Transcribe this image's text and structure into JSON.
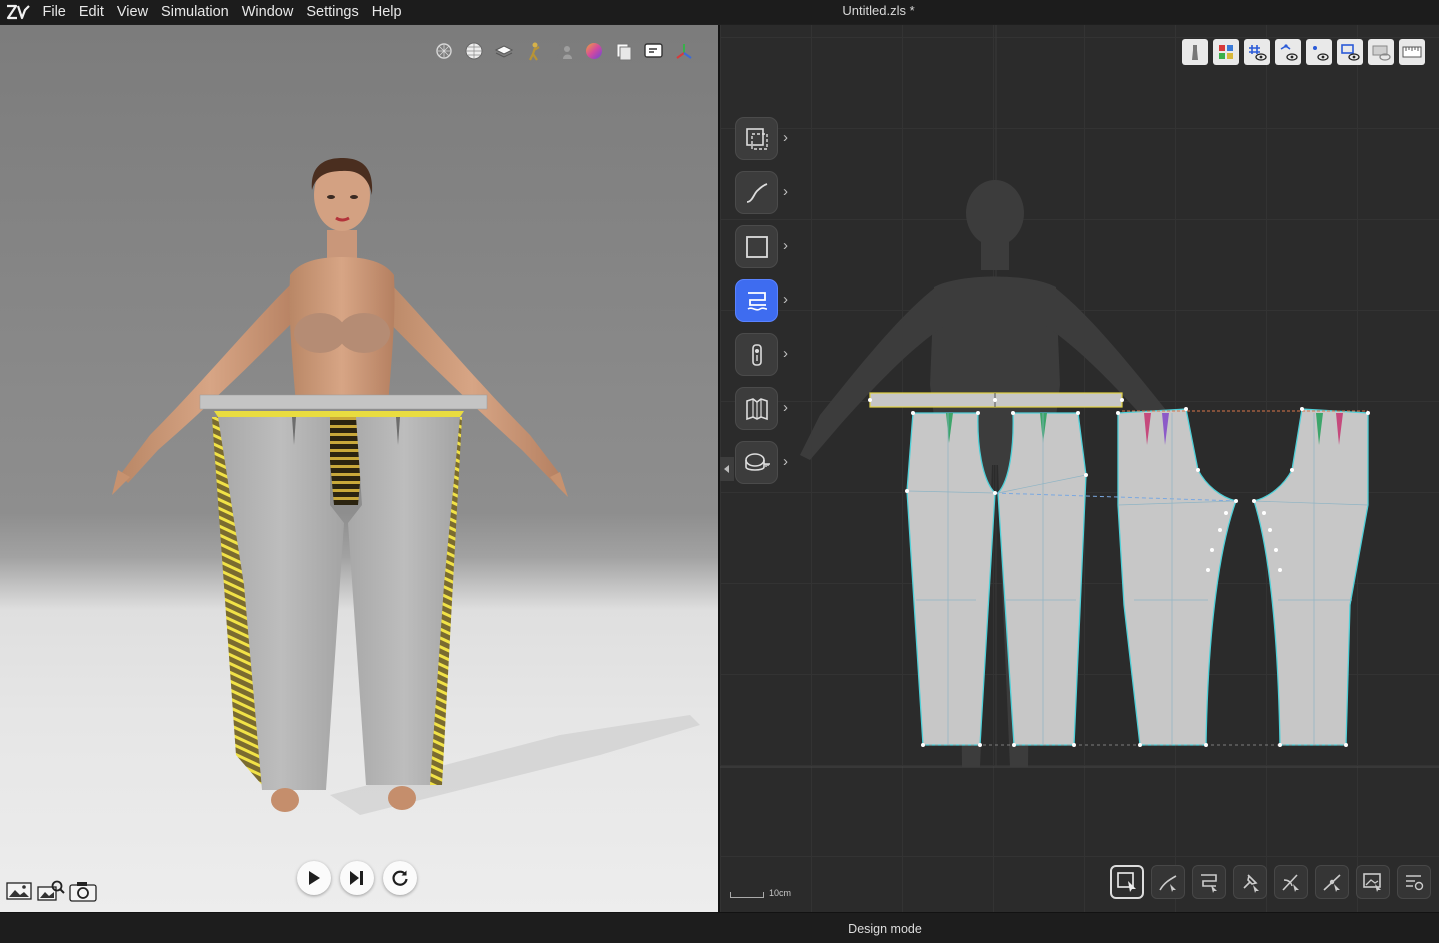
{
  "app": {
    "logo_text": "ZW",
    "menu": [
      "File",
      "Edit",
      "View",
      "Simulation",
      "Window",
      "Settings",
      "Help"
    ],
    "document_title": "Untitled.zls *"
  },
  "viewport3d": {
    "toolbar_icons": [
      "particle-icon",
      "sphere-shading-icon",
      "fabric-layer-icon",
      "avatar-pose-icon",
      "avatar-group-icon",
      "color-sphere-icon",
      "garment-copy-icon",
      "sewing-icon",
      "gizmo-icon"
    ],
    "simulation_controls": [
      "play-icon",
      "step-forward-icon",
      "reset-icon"
    ],
    "capture_tools": [
      "snapshot-gallery-icon",
      "render-search-icon",
      "camera-icon"
    ]
  },
  "viewport2d": {
    "top_toolbar_icons": [
      "avatar-silhouette-icon",
      "color-grid-icon",
      "grid-hash-eye-icon",
      "point-eye-icon",
      "baseline-eye-icon",
      "seam-eye-icon",
      "sheet-eye-icon",
      "ruler-icon"
    ],
    "tool_palette": [
      {
        "name": "transform-tool",
        "icon": "transform-icon",
        "active": false
      },
      {
        "name": "curve-tool",
        "icon": "curve-icon",
        "active": false
      },
      {
        "name": "rectangle-tool",
        "icon": "rectangle-icon",
        "active": false
      },
      {
        "name": "sewing-tool",
        "icon": "sewing-icon",
        "active": true
      },
      {
        "name": "zipper-tool",
        "icon": "zipper-icon",
        "active": false
      },
      {
        "name": "fold-tool",
        "icon": "fold-icon",
        "active": false
      },
      {
        "name": "measure-tool",
        "icon": "tape-measure-icon",
        "active": false
      }
    ],
    "scale_label": "10cm",
    "bottom_toolbar_icons": [
      "select-box-icon",
      "edit-curve-icon",
      "seam-edit-icon",
      "pin-edit-icon",
      "cut-line-icon",
      "point-add-icon",
      "image-edit-icon",
      "settings-list-icon"
    ]
  },
  "status": {
    "mode": "Design mode"
  },
  "colors": {
    "active_tool": "#3e6cf0",
    "seam_yellow": "#e8d83a",
    "seam_cyan": "#4fd0d8",
    "pattern_fill": "#c7c7c7"
  }
}
